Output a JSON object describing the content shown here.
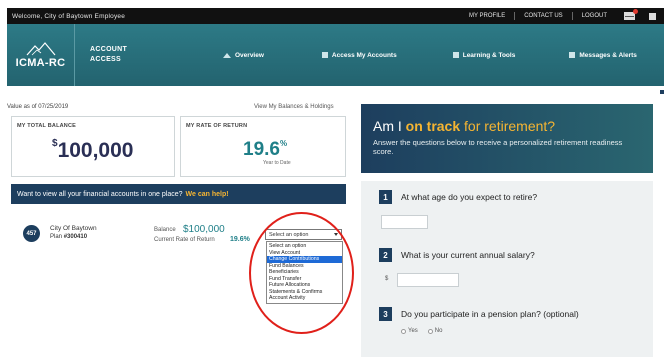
{
  "topbar": {
    "welcome": "Welcome, City of Baytown Employee",
    "links": [
      "MY PROFILE",
      "CONTACT US",
      "LOGOUT"
    ],
    "icons": [
      "mail-icon",
      "print-icon"
    ],
    "mail_badge_color": "#e03a2f"
  },
  "header": {
    "brand": "ICMA-RC",
    "title_line1": "ACCOUNT",
    "title_line2": "ACCESS",
    "tabs": [
      {
        "label": "Overview",
        "icon": "home-icon"
      },
      {
        "label": "Access My Accounts",
        "icon": "accounts-icon"
      },
      {
        "label": "Learning & Tools",
        "icon": "tools-icon"
      },
      {
        "label": "Messages & Alerts",
        "icon": "messages-icon"
      }
    ],
    "color": "#2d7a86"
  },
  "summary": {
    "as_of": "Value as of 07/25/2019",
    "view_link": "View My Balances & Holdings",
    "balance_label": "MY TOTAL BALANCE",
    "balance_currency": "$",
    "balance_value": "100,000",
    "rate_label": "MY RATE OF RETURN",
    "rate_value": "19.6",
    "rate_unit": "%",
    "rate_sub": "Year to Date"
  },
  "promo": {
    "text": "Want to view all your financial accounts in one place?",
    "help": "We can help!"
  },
  "plan": {
    "badge": "457",
    "name": "City Of Baytown",
    "plan_prefix": "Plan",
    "plan_number": "#300410",
    "balance_label": "Balance",
    "balance_value": "$100,000",
    "rate_label": "Current Rate of Return",
    "rate_value": "19.6%"
  },
  "action_select": {
    "value": "Select an option",
    "options": [
      "Select an option",
      "View Account",
      "Change Contributions",
      "Fund Balances",
      "Beneficiaries",
      "Fund Transfer",
      "Future Allocations",
      "Statements & Confirms",
      "Account Activity"
    ],
    "highlighted_index": 2
  },
  "hero": {
    "prefix": "Am I",
    "on_track": "on track",
    "suffix": "for retirement?",
    "description": "Answer the questions below to receive a personalized retirement readiness score."
  },
  "questions": [
    {
      "number": "1",
      "text": "At what age do you expect to retire?"
    },
    {
      "number": "2",
      "text": "What is your current annual salary?",
      "currency": "$"
    },
    {
      "number": "3",
      "text": "Do you participate in a pension plan? (optional)",
      "options": [
        "Yes",
        "No"
      ]
    }
  ]
}
